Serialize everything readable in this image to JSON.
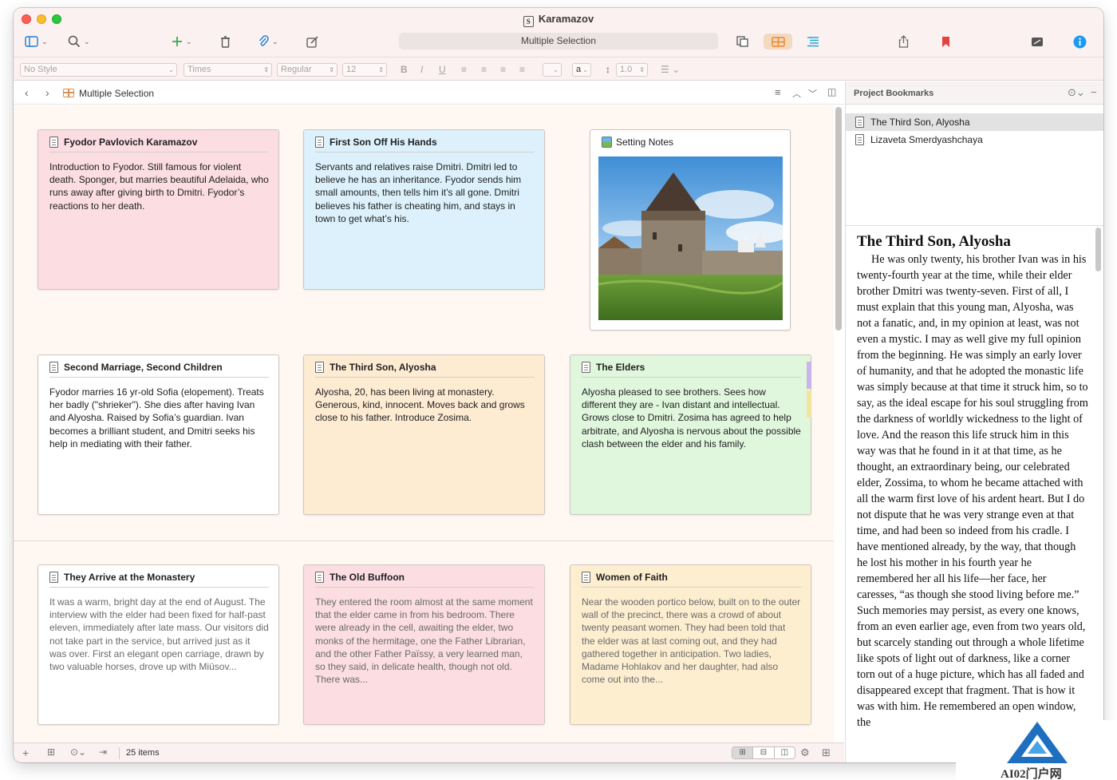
{
  "window": {
    "title": "Karamazov",
    "selection_label": "Multiple Selection"
  },
  "formatbar": {
    "style": "No Style",
    "font": "Times",
    "weight": "Regular",
    "size": "12",
    "bold": "B",
    "italic": "I",
    "underline": "U",
    "highlight": "a",
    "line_spacing": "1.0"
  },
  "pathbar": {
    "crumb": "Multiple Selection"
  },
  "cards": [
    {
      "title": "Fyodor Pavlovich  Karamazov",
      "body": "Introduction to Fyodor. Still famous for violent death. Sponger, but marries beautiful Adelaida, who runs away after giving birth to Dmitri. Fyodor’s reactions to her death."
    },
    {
      "title": "First Son Off His Hands",
      "body": "Servants and relatives raise Dmitri. Dmitri led to believe he has an inheritance. Fyodor sends him small amounts, then tells him it’s all gone. Dmitri believes his father is cheating him, and stays in town to get what’s his."
    },
    {
      "title": "Setting Notes",
      "body": ""
    },
    {
      "title": "Second Marriage, Second Children",
      "body": "Fyodor marries 16 yr-old Sofia (elopement). Treats her badly (\"shrieker\"). She dies after having Ivan and Alyosha. Raised by Sofia’s guardian. Ivan becomes a brilliant student, and Dmitri seeks his help in mediating with their father."
    },
    {
      "title": "The Third Son, Alyosha",
      "body": "Alyosha, 20, has been living at monastery. Generous, kind, innocent. Moves back and grows close to his father. Introduce Zosima."
    },
    {
      "title": "The Elders",
      "body": "Alyosha pleased to see brothers. Sees how different they are - Ivan distant and intellectual. Grows close to Dmitri. Zosima has agreed to help arbitrate, and Alyosha is nervous about the possible clash between the elder and his family."
    },
    {
      "title": "They Arrive at the Monastery",
      "body": "It was a warm, bright day at the end of August. The interview with the elder had been fixed for half-past eleven, immediately after late mass. Our visitors did not take part in the service, but arrived just as it was over. First an elegant open carriage, drawn by two valuable horses, drove up with Miüsov..."
    },
    {
      "title": "The Old Buffoon",
      "body": "They entered the room almost at the same moment that the elder came in from his bedroom. There were already in the cell, awaiting the elder, two monks of the hermitage, one the Father Librarian, and the other Father Païssy, a very learned man, so they said, in delicate health, though not old. There was..."
    },
    {
      "title": "Women of Faith",
      "body": "Near the wooden portico below, built on to the outer wall of the precinct, there was a crowd of about twenty peasant women. They had been told that the elder was at last coming out, and they had gathered together in anticipation. Two ladies, Madame Hohlakov and her daughter, had also come out into the..."
    }
  ],
  "footer": {
    "item_count": "25 items"
  },
  "inspector": {
    "title": "Project Bookmarks",
    "bookmarks": [
      "The Third Son, Alyosha",
      "Lizaveta Smerdyashchaya"
    ],
    "reader_heading": "The Third Son, Alyosha",
    "reader_text": "He was only twenty, his brother Ivan was in his twenty-fourth year at the time, while their elder brother Dmitri was twenty-seven. First of all, I must explain that this young man, Alyosha, was not a fanatic, and, in my opinion at least, was not even a mystic. I may as well give my full opinion from the beginning. He was simply an early lover of humanity, and that he adopted the monastic life was simply because at that time it struck him, so to say, as the ideal escape for his soul struggling from the darkness of worldly wickedness to the light of love. And the reason this life struck him in this way was that he found in it at that time, as he thought, an extraordinary being, our celebrated elder, Zossima, to whom he became attached with all the warm first love of his ardent heart. But I do not dispute that he was very strange even at that time, and had been so indeed from his cradle. I have mentioned already, by the way, that though he lost his mother in his fourth year he remembered her all his life—her face, her caresses, “as though she stood living before me.” Such memories may persist, as every one knows, from an even earlier age, even from two years old, but scarcely standing out through a whole lifetime like spots of light out of darkness, like a corner torn out of a huge picture, which has all faded and disappeared except that fragment. That is how it was with him. He remembered an open window, the"
  },
  "watermark": "AI02门户网",
  "colors": {
    "card_pink": "#fbdde2",
    "card_blue": "#dcf1fb",
    "card_orange": "#fdebd2",
    "card_green": "#e0f7dd",
    "accent_orange": "#e9892f",
    "bookmark_red": "#e0443e",
    "info_blue": "#1e9bf0"
  },
  "icons": [
    "sidebar-icon",
    "search-icon",
    "add-icon",
    "trash-icon",
    "paperclip-icon",
    "compose-icon",
    "outline-mode-icon",
    "corkboard-mode-icon",
    "scrivenings-mode-icon",
    "share-icon",
    "bookmark-icon",
    "composition-icon",
    "info-icon"
  ]
}
